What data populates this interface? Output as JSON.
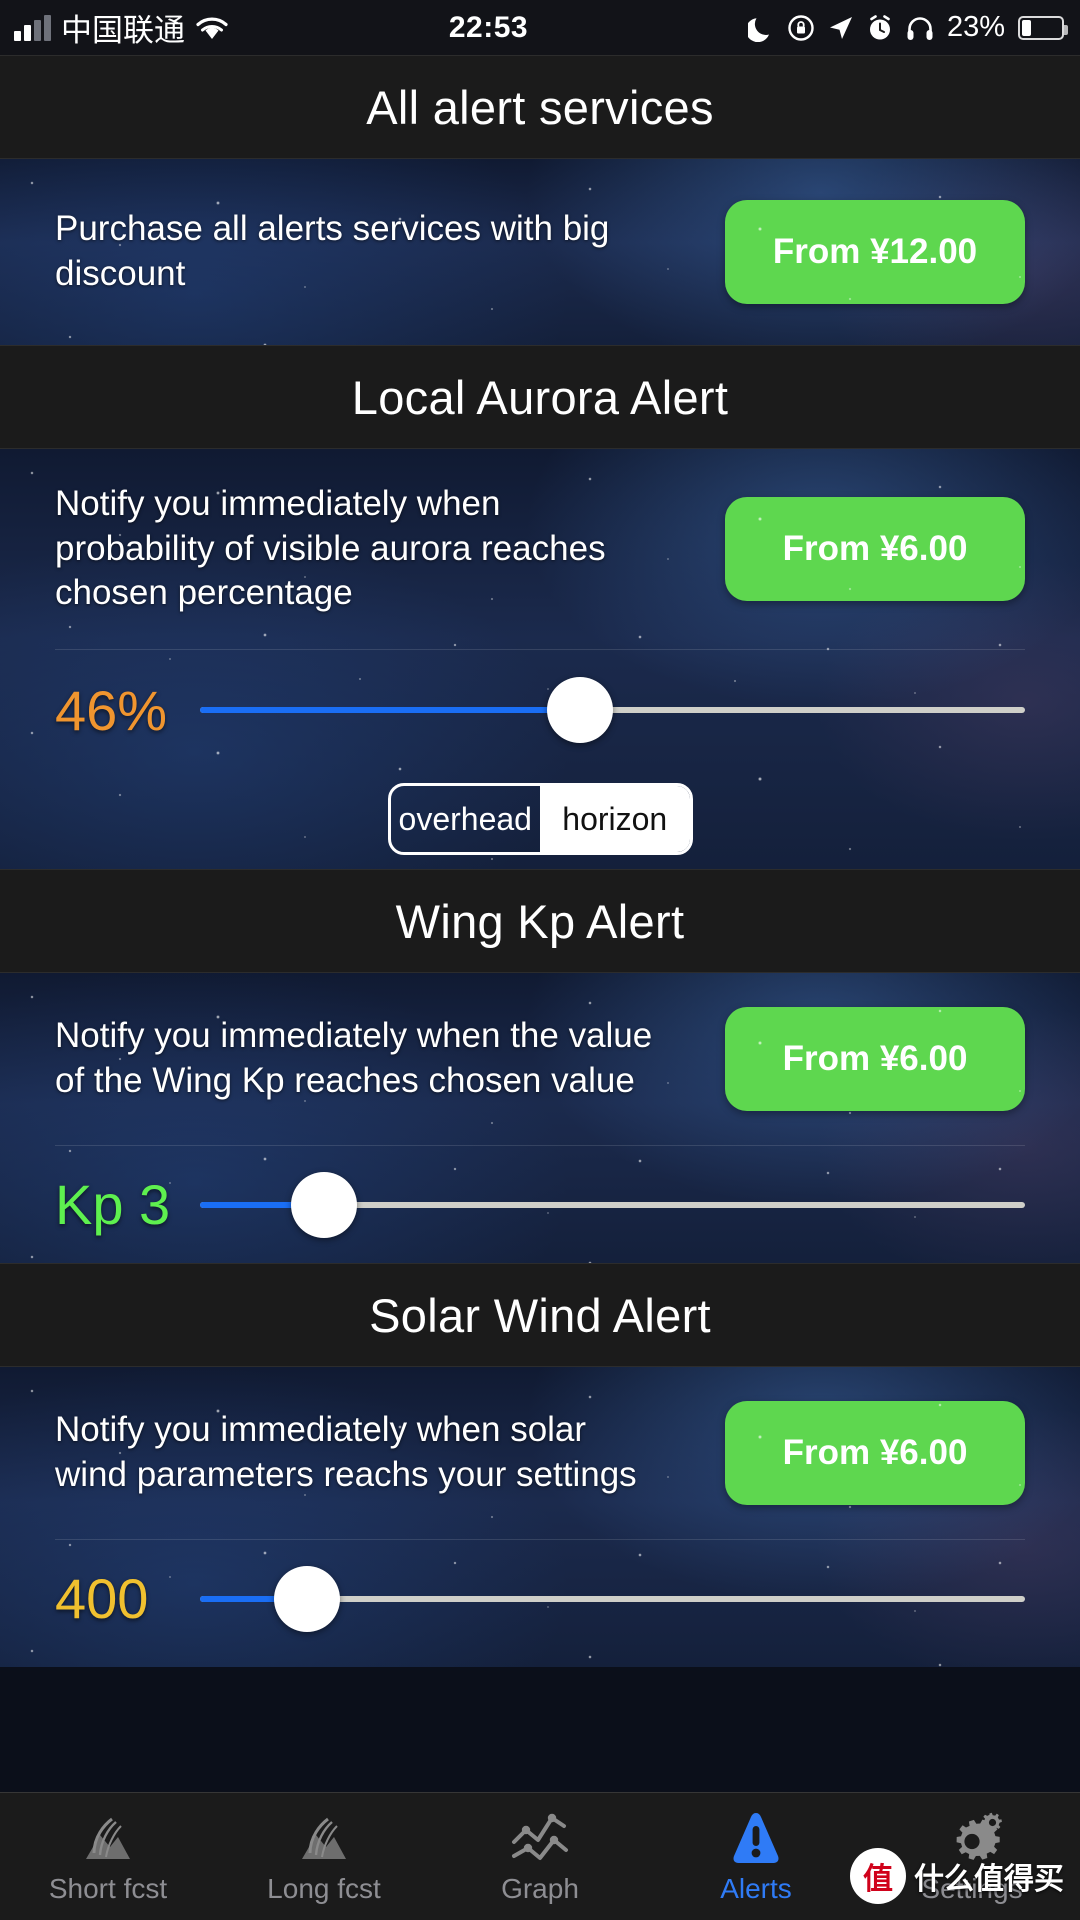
{
  "statusbar": {
    "carrier": "中国联通",
    "time": "22:53",
    "battery_percent": "23%",
    "icons": [
      "signal-icon",
      "wifi-icon",
      "moon-icon",
      "rotation-lock-icon",
      "location-arrow-icon",
      "alarm-clock-icon",
      "headphones-icon",
      "battery-icon"
    ]
  },
  "sections": [
    {
      "title": "All alert services",
      "description": "Purchase all alerts services with big discount",
      "price": "From ¥12.00"
    },
    {
      "title": "Local Aurora Alert",
      "description": "Notify you immediately when probability of visible aurora reaches chosen percentage",
      "price": "From ¥6.00",
      "slider": {
        "value_label": "46%",
        "percent": 46
      },
      "segmented": {
        "options": [
          "overhead",
          "horizon"
        ],
        "selected": "horizon"
      }
    },
    {
      "title": "Wing Kp Alert",
      "description": "Notify you immediately when the value of the Wing Kp reaches chosen value",
      "price": "From ¥6.00",
      "slider": {
        "value_label": "Kp 3",
        "percent": 15
      }
    },
    {
      "title": "Solar Wind Alert",
      "description": "Notify you immediately when solar wind parameters reachs your settings",
      "price": "From ¥6.00",
      "slider": {
        "value_label": "400",
        "percent": 13
      }
    }
  ],
  "tabbar": {
    "items": [
      {
        "label": "Short fcst",
        "icon": "aurora-mountain-icon",
        "active": false
      },
      {
        "label": "Long fcst",
        "icon": "aurora-mountain-icon",
        "active": false
      },
      {
        "label": "Graph",
        "icon": "line-chart-icon",
        "active": false
      },
      {
        "label": "Alerts",
        "icon": "alert-triangle-icon",
        "active": true
      },
      {
        "label": "Settings",
        "icon": "gears-icon",
        "active": false
      }
    ]
  },
  "watermark": {
    "badge": "值",
    "text": "什么值得买"
  },
  "colors": {
    "accent_green": "#5ed74f",
    "slider_fill_blue": "#1a6ef5",
    "percent_orange": "#f0952f",
    "kp_green": "#5ef04f",
    "tab_active_blue": "#2f7bf6"
  }
}
